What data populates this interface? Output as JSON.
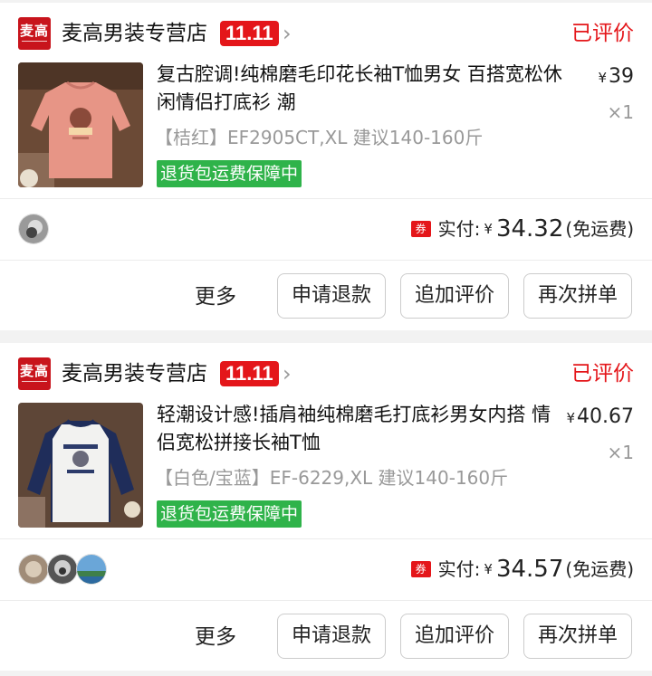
{
  "orders": [
    {
      "shop_logo_text": "麦高",
      "shop_name": "麦高男装专营店",
      "promo_badge": "11.11",
      "status": "已评价",
      "product_title": "复古腔调!纯棉磨毛印花长袖T恤男女 百搭宽松休闲情侣打底衫 潮",
      "unit_price": "39",
      "currency": "¥",
      "quantity": "×1",
      "sku": "【桔红】EF2905CT,XL 建议140-160斤",
      "return_tag": "退货包运费保障中",
      "coupon_icon": "券",
      "paid_label": "实付:",
      "paid_amount": "34.32",
      "shipping_note": "(免运费)",
      "more_label": "更多",
      "refund_button": "申请退款",
      "review_button": "追加评价",
      "rebuy_button": "再次拼单"
    },
    {
      "shop_logo_text": "麦高",
      "shop_name": "麦高男装专营店",
      "promo_badge": "11.11",
      "status": "已评价",
      "product_title": "轻潮设计感!插肩袖纯棉磨毛打底衫男女内搭 情侣宽松拼接长袖T恤",
      "unit_price": "40.67",
      "currency": "¥",
      "quantity": "×1",
      "sku": "【白色/宝蓝】EF-6229,XL 建议140-160斤",
      "return_tag": "退货包运费保障中",
      "coupon_icon": "券",
      "paid_label": "实付:",
      "paid_amount": "34.57",
      "shipping_note": "(免运费)",
      "more_label": "更多",
      "refund_button": "申请退款",
      "review_button": "追加评价",
      "rebuy_button": "再次拼单"
    }
  ],
  "colors": {
    "accent_red": "#e4161a",
    "return_green": "#2fb34a",
    "shirt_orange": "#e79586",
    "shirt_navy": "#1f2d5a"
  },
  "icons": [
    "shop-logo-icon",
    "chevron-right-icon",
    "coupon-icon",
    "avatar"
  ]
}
